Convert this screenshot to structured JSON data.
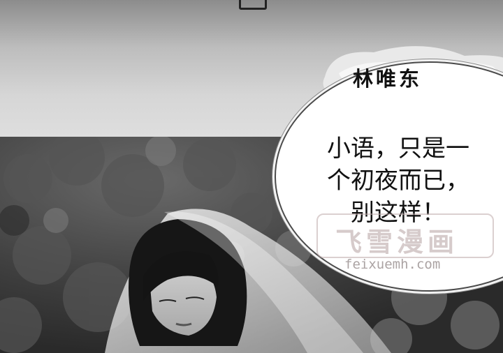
{
  "comic_panel": {
    "speaker_name": "林唯东",
    "dialogue_lines": [
      "小语，只是一",
      "个初夜而已，",
      "别这样！"
    ]
  },
  "watermark": {
    "title": "飞雪漫画",
    "url": "feixuemh.com"
  }
}
